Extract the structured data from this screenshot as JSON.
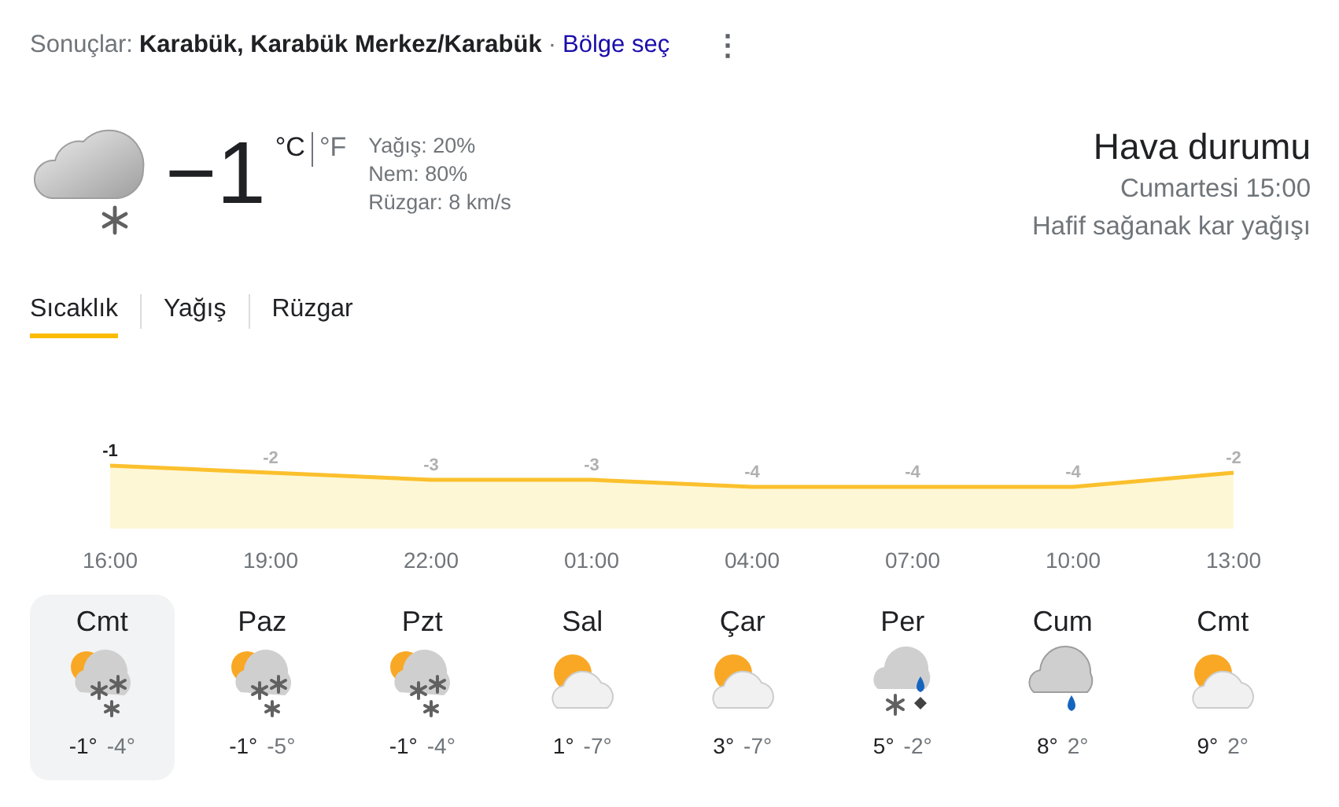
{
  "header": {
    "prefix": "Sonuçlar:",
    "location": "Karabük, Karabük Merkez/Karabük",
    "separator": "·",
    "link": "Bölge seç",
    "menu": "⋮"
  },
  "current": {
    "kind": "cloud_snow",
    "temperature": "−1",
    "unit_c": "°C",
    "unit_f": "°F",
    "unit_c_selected": true,
    "details": [
      "Yağış: 20%",
      "Nem: 80%",
      "Rüzgar: 8 km/s"
    ],
    "title": "Hava durumu",
    "time": "Cumartesi 15:00",
    "condition": "Hafif sağanak kar yağışı"
  },
  "tabs": [
    {
      "label": "Sıcaklık",
      "selected": true
    },
    {
      "label": "Yağış",
      "selected": false
    },
    {
      "label": "Rüzgar",
      "selected": false
    }
  ],
  "chart_data": {
    "type": "area",
    "categories": [
      "16:00",
      "19:00",
      "22:00",
      "01:00",
      "04:00",
      "07:00",
      "10:00",
      "13:00"
    ],
    "series": [
      {
        "color": "#fbc02d",
        "values": [
          -1,
          -2,
          -3,
          -3,
          -4,
          -4,
          -4,
          -2
        ]
      }
    ],
    "data_labels": true
  },
  "days": [
    {
      "day": "Cmt",
      "kind": "partly_snow",
      "high": "-1°",
      "low": "-4°",
      "selected": true
    },
    {
      "day": "Paz",
      "kind": "partly_snow",
      "high": "-1°",
      "low": "-5°",
      "selected": false
    },
    {
      "day": "Pzt",
      "kind": "partly_snow",
      "high": "-1°",
      "low": "-4°",
      "selected": false
    },
    {
      "day": "Sal",
      "kind": "partly_cloudy",
      "high": "1°",
      "low": "-7°",
      "selected": false
    },
    {
      "day": "Çar",
      "kind": "partly_cloudy",
      "high": "3°",
      "low": "-7°",
      "selected": false
    },
    {
      "day": "Per",
      "kind": "snow_rain",
      "high": "5°",
      "low": "-2°",
      "selected": false
    },
    {
      "day": "Cum",
      "kind": "rain",
      "high": "8°",
      "low": "2°",
      "selected": false
    },
    {
      "day": "Cmt",
      "kind": "partly_cloudy",
      "high": "9°",
      "low": "2°",
      "selected": false
    }
  ]
}
